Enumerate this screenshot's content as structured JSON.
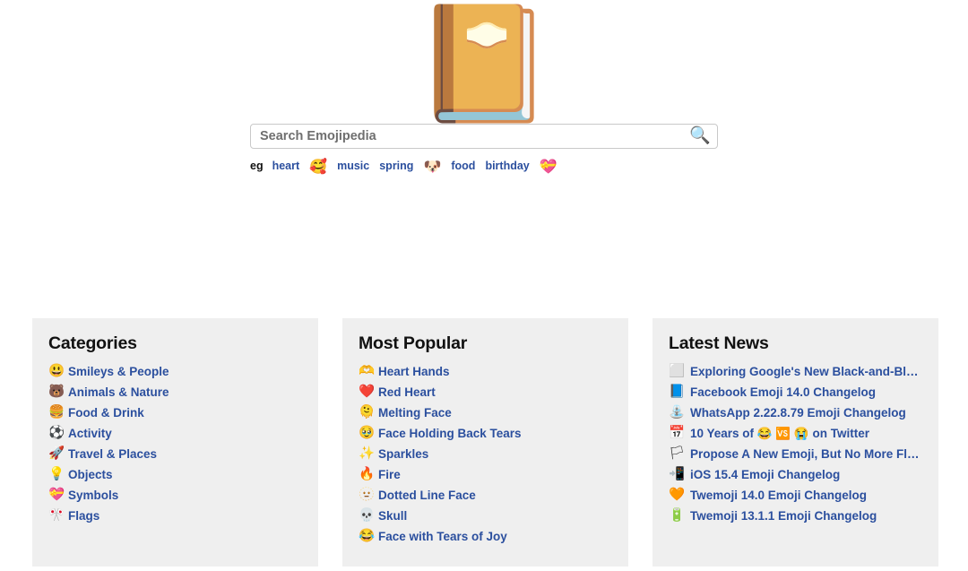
{
  "site": {
    "name": "Emojipedia"
  },
  "hero": {
    "logo_icon": "notebook-with-decorative-cover",
    "logo_glyph": "📔"
  },
  "search": {
    "placeholder": "Search Emojipedia",
    "value": "",
    "icon": "magnifying-glass-icon",
    "icon_glyph": "🔍"
  },
  "examples": {
    "label": "eg",
    "items": [
      {
        "text": "heart",
        "type": "text"
      },
      {
        "text": "🥰",
        "type": "emoji",
        "name": "smiling-face-with-hearts"
      },
      {
        "text": "music",
        "type": "text"
      },
      {
        "text": "spring",
        "type": "text"
      },
      {
        "text": "🐶",
        "type": "emoji",
        "name": "dog-face"
      },
      {
        "text": "food",
        "type": "text"
      },
      {
        "text": "birthday",
        "type": "text"
      },
      {
        "text": "💝",
        "type": "emoji",
        "name": "heart-with-ribbon"
      }
    ]
  },
  "panels": {
    "categories": {
      "title": "Categories",
      "items": [
        {
          "icon": "😃",
          "icon_name": "grinning-face-with-big-eyes",
          "label": "Smileys & People"
        },
        {
          "icon": "🐻",
          "icon_name": "bear-face",
          "label": "Animals & Nature"
        },
        {
          "icon": "🍔",
          "icon_name": "hamburger",
          "label": "Food & Drink"
        },
        {
          "icon": "⚽",
          "icon_name": "soccer-ball",
          "label": "Activity"
        },
        {
          "icon": "🚀",
          "icon_name": "rocket",
          "label": "Travel & Places"
        },
        {
          "icon": "💡",
          "icon_name": "light-bulb",
          "label": "Objects"
        },
        {
          "icon": "💝",
          "icon_name": "heart-with-ribbon",
          "label": "Symbols"
        },
        {
          "icon": "🎌",
          "icon_name": "crossed-flags",
          "label": "Flags"
        }
      ]
    },
    "most_popular": {
      "title": "Most Popular",
      "items": [
        {
          "icon": "🫶",
          "icon_name": "heart-hands",
          "label": "Heart Hands"
        },
        {
          "icon": "❤️",
          "icon_name": "red-heart",
          "label": "Red Heart"
        },
        {
          "icon": "🫠",
          "icon_name": "melting-face",
          "label": "Melting Face"
        },
        {
          "icon": "🥹",
          "icon_name": "face-holding-back-tears",
          "label": "Face Holding Back Tears"
        },
        {
          "icon": "✨",
          "icon_name": "sparkles",
          "label": "Sparkles"
        },
        {
          "icon": "🔥",
          "icon_name": "fire",
          "label": "Fire"
        },
        {
          "icon": "🫥",
          "icon_name": "dotted-line-face",
          "label": "Dotted Line Face"
        },
        {
          "icon": "💀",
          "icon_name": "skull",
          "label": "Skull"
        },
        {
          "icon": "😂",
          "icon_name": "face-with-tears-of-joy",
          "label": "Face with Tears of Joy"
        }
      ]
    },
    "latest_news": {
      "title": "Latest News",
      "items": [
        {
          "icon": "⬜",
          "icon_name": "white-large-square",
          "label": "Exploring Google's New Black-and-Bl…"
        },
        {
          "icon": "📘",
          "icon_name": "blue-book",
          "label": "Facebook Emoji 14.0 Changelog"
        },
        {
          "icon": "⛲",
          "icon_name": "fountain",
          "label": "WhatsApp 2.22.8.79 Emoji Changelog"
        },
        {
          "icon": "📅",
          "icon_name": "calendar",
          "label": "10 Years of 😂 🆚 😭 on Twitter",
          "has_inline_emoji": true
        },
        {
          "icon": "🏳",
          "icon_name": "white-flag",
          "label": "Propose A New Emoji, But No More Fl…"
        },
        {
          "icon": "📲",
          "icon_name": "mobile-phone-with-arrow",
          "label": "iOS 15.4 Emoji Changelog"
        },
        {
          "icon": "🧡",
          "icon_name": "orange-heart",
          "label": "Twemoji 14.0 Emoji Changelog"
        },
        {
          "icon": "🔋",
          "icon_name": "battery",
          "label": "Twemoji 13.1.1 Emoji Changelog"
        }
      ]
    }
  },
  "colors": {
    "link": "#2b4f9e",
    "panel_bg": "#efefef",
    "page_bg": "#ffffff",
    "heading": "#111111",
    "placeholder": "#6f6f6f"
  }
}
